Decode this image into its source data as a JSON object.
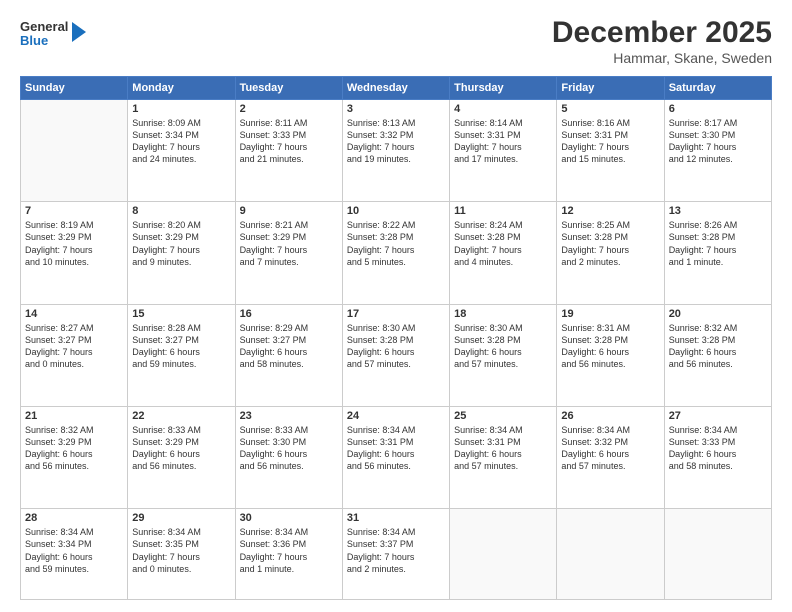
{
  "header": {
    "logo": {
      "general": "General",
      "blue": "Blue"
    },
    "title": "December 2025",
    "location": "Hammar, Skane, Sweden"
  },
  "days_of_week": [
    "Sunday",
    "Monday",
    "Tuesday",
    "Wednesday",
    "Thursday",
    "Friday",
    "Saturday"
  ],
  "weeks": [
    [
      {
        "day": "",
        "content": ""
      },
      {
        "day": "1",
        "content": "Sunrise: 8:09 AM\nSunset: 3:34 PM\nDaylight: 7 hours\nand 24 minutes."
      },
      {
        "day": "2",
        "content": "Sunrise: 8:11 AM\nSunset: 3:33 PM\nDaylight: 7 hours\nand 21 minutes."
      },
      {
        "day": "3",
        "content": "Sunrise: 8:13 AM\nSunset: 3:32 PM\nDaylight: 7 hours\nand 19 minutes."
      },
      {
        "day": "4",
        "content": "Sunrise: 8:14 AM\nSunset: 3:31 PM\nDaylight: 7 hours\nand 17 minutes."
      },
      {
        "day": "5",
        "content": "Sunrise: 8:16 AM\nSunset: 3:31 PM\nDaylight: 7 hours\nand 15 minutes."
      },
      {
        "day": "6",
        "content": "Sunrise: 8:17 AM\nSunset: 3:30 PM\nDaylight: 7 hours\nand 12 minutes."
      }
    ],
    [
      {
        "day": "7",
        "content": "Sunrise: 8:19 AM\nSunset: 3:29 PM\nDaylight: 7 hours\nand 10 minutes."
      },
      {
        "day": "8",
        "content": "Sunrise: 8:20 AM\nSunset: 3:29 PM\nDaylight: 7 hours\nand 9 minutes."
      },
      {
        "day": "9",
        "content": "Sunrise: 8:21 AM\nSunset: 3:29 PM\nDaylight: 7 hours\nand 7 minutes."
      },
      {
        "day": "10",
        "content": "Sunrise: 8:22 AM\nSunset: 3:28 PM\nDaylight: 7 hours\nand 5 minutes."
      },
      {
        "day": "11",
        "content": "Sunrise: 8:24 AM\nSunset: 3:28 PM\nDaylight: 7 hours\nand 4 minutes."
      },
      {
        "day": "12",
        "content": "Sunrise: 8:25 AM\nSunset: 3:28 PM\nDaylight: 7 hours\nand 2 minutes."
      },
      {
        "day": "13",
        "content": "Sunrise: 8:26 AM\nSunset: 3:28 PM\nDaylight: 7 hours\nand 1 minute."
      }
    ],
    [
      {
        "day": "14",
        "content": "Sunrise: 8:27 AM\nSunset: 3:27 PM\nDaylight: 7 hours\nand 0 minutes."
      },
      {
        "day": "15",
        "content": "Sunrise: 8:28 AM\nSunset: 3:27 PM\nDaylight: 6 hours\nand 59 minutes."
      },
      {
        "day": "16",
        "content": "Sunrise: 8:29 AM\nSunset: 3:27 PM\nDaylight: 6 hours\nand 58 minutes."
      },
      {
        "day": "17",
        "content": "Sunrise: 8:30 AM\nSunset: 3:28 PM\nDaylight: 6 hours\nand 57 minutes."
      },
      {
        "day": "18",
        "content": "Sunrise: 8:30 AM\nSunset: 3:28 PM\nDaylight: 6 hours\nand 57 minutes."
      },
      {
        "day": "19",
        "content": "Sunrise: 8:31 AM\nSunset: 3:28 PM\nDaylight: 6 hours\nand 56 minutes."
      },
      {
        "day": "20",
        "content": "Sunrise: 8:32 AM\nSunset: 3:28 PM\nDaylight: 6 hours\nand 56 minutes."
      }
    ],
    [
      {
        "day": "21",
        "content": "Sunrise: 8:32 AM\nSunset: 3:29 PM\nDaylight: 6 hours\nand 56 minutes."
      },
      {
        "day": "22",
        "content": "Sunrise: 8:33 AM\nSunset: 3:29 PM\nDaylight: 6 hours\nand 56 minutes."
      },
      {
        "day": "23",
        "content": "Sunrise: 8:33 AM\nSunset: 3:30 PM\nDaylight: 6 hours\nand 56 minutes."
      },
      {
        "day": "24",
        "content": "Sunrise: 8:34 AM\nSunset: 3:31 PM\nDaylight: 6 hours\nand 56 minutes."
      },
      {
        "day": "25",
        "content": "Sunrise: 8:34 AM\nSunset: 3:31 PM\nDaylight: 6 hours\nand 57 minutes."
      },
      {
        "day": "26",
        "content": "Sunrise: 8:34 AM\nSunset: 3:32 PM\nDaylight: 6 hours\nand 57 minutes."
      },
      {
        "day": "27",
        "content": "Sunrise: 8:34 AM\nSunset: 3:33 PM\nDaylight: 6 hours\nand 58 minutes."
      }
    ],
    [
      {
        "day": "28",
        "content": "Sunrise: 8:34 AM\nSunset: 3:34 PM\nDaylight: 6 hours\nand 59 minutes."
      },
      {
        "day": "29",
        "content": "Sunrise: 8:34 AM\nSunset: 3:35 PM\nDaylight: 7 hours\nand 0 minutes."
      },
      {
        "day": "30",
        "content": "Sunrise: 8:34 AM\nSunset: 3:36 PM\nDaylight: 7 hours\nand 1 minute."
      },
      {
        "day": "31",
        "content": "Sunrise: 8:34 AM\nSunset: 3:37 PM\nDaylight: 7 hours\nand 2 minutes."
      },
      {
        "day": "",
        "content": ""
      },
      {
        "day": "",
        "content": ""
      },
      {
        "day": "",
        "content": ""
      }
    ]
  ]
}
